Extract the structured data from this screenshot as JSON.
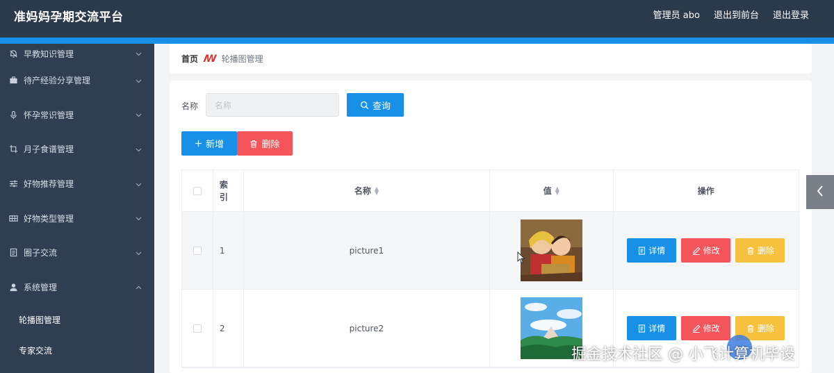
{
  "header": {
    "brand": "准妈妈孕期交流平台",
    "user": "管理员 abo",
    "front_link": "退出到前台",
    "logout": "退出登录"
  },
  "sidebar": {
    "items": [
      {
        "label": "早教知识管理",
        "icon": "bell-icon",
        "expanded": false
      },
      {
        "label": "待产经验分享管理",
        "icon": "briefcase-icon",
        "expanded": false
      },
      {
        "label": "怀孕常识管理",
        "icon": "microphone-icon",
        "expanded": false
      },
      {
        "label": "月子食谱管理",
        "icon": "crop-icon",
        "expanded": false
      },
      {
        "label": "好物推荐管理",
        "icon": "sliders-icon",
        "expanded": false
      },
      {
        "label": "好物类型管理",
        "icon": "grid-icon",
        "expanded": false
      },
      {
        "label": "圈子交流",
        "icon": "document-icon",
        "expanded": false
      },
      {
        "label": "系统管理",
        "icon": "user-icon",
        "expanded": true
      }
    ],
    "sub_items": [
      {
        "label": "轮播图管理",
        "active": true
      },
      {
        "label": "专家交流",
        "active": false
      }
    ]
  },
  "breadcrumb": {
    "home": "首页",
    "current": "轮播图管理"
  },
  "search": {
    "label": "名称",
    "placeholder": "名称",
    "query_button": "查询"
  },
  "actions": {
    "add": "新增",
    "delete": "删除"
  },
  "table": {
    "columns": [
      "索引",
      "名称",
      "值",
      "操作"
    ],
    "rows": [
      {
        "index": "1",
        "name": "picture1",
        "thumb": "cartoon-couple-image"
      },
      {
        "index": "2",
        "name": "picture2",
        "thumb": "sky-landscape-image"
      }
    ],
    "row_actions": {
      "detail": "详情",
      "edit": "修改",
      "delete": "删除"
    }
  },
  "watermark": "掘金技术社区 @ 小飞计算机毕设",
  "colors": {
    "header_bg": "#2b3a4b",
    "sidebar_bg": "#2f3f51",
    "primary": "#1890e8",
    "danger": "#f3555a",
    "warning": "#f6c23e"
  }
}
